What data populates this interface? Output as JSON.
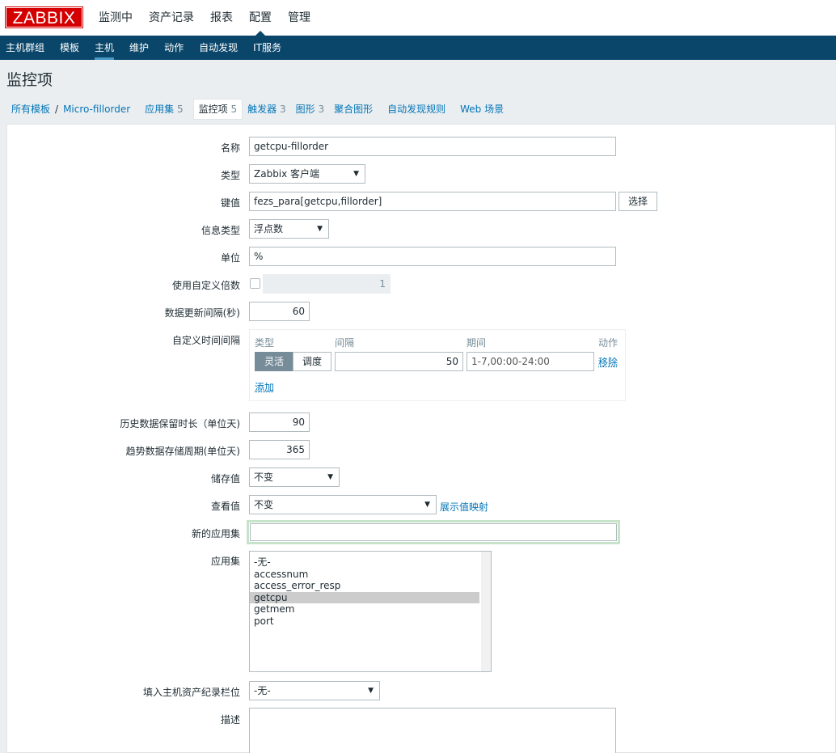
{
  "logo": "ZABBIX",
  "top_nav": [
    "监测中",
    "资产记录",
    "报表",
    "配置",
    "管理"
  ],
  "top_nav_active": "配置",
  "sub_nav": [
    "主机群组",
    "模板",
    "主机",
    "维护",
    "动作",
    "自动发现",
    "IT服务"
  ],
  "sub_nav_active": "主机",
  "page_title": "监控项",
  "breadcrumb": {
    "all_templates": "所有模板",
    "separator": "/",
    "template": "Micro-fillorder",
    "tabs": [
      {
        "label": "应用集",
        "count": "5"
      },
      {
        "label": "监控项",
        "count": "5"
      },
      {
        "label": "触发器",
        "count": "3"
      },
      {
        "label": "图形",
        "count": "3"
      },
      {
        "label": "聚合图形",
        "count": ""
      },
      {
        "label": "自动发现规则",
        "count": ""
      },
      {
        "label": "Web 场景",
        "count": ""
      }
    ],
    "active_tab": "监控项"
  },
  "form": {
    "name_label": "名称",
    "name_value": "getcpu-fillorder",
    "type_label": "类型",
    "type_value": "Zabbix 客户端",
    "key_label": "键值",
    "key_value": "fezs_para[getcpu,fillorder]",
    "key_select_button": "选择",
    "info_type_label": "信息类型",
    "info_type_value": "浮点数",
    "units_label": "单位",
    "units_value": "%",
    "multiplier_label": "使用自定义倍数",
    "multiplier_value": "1",
    "update_interval_label": "数据更新间隔(秒)",
    "update_interval_value": "60",
    "custom_intervals_label": "自定义时间间隔",
    "custom_intervals": {
      "headers": {
        "type": "类型",
        "interval": "间隔",
        "period": "期间",
        "action": "动作"
      },
      "row": {
        "flexible": "灵活",
        "scheduling": "调度",
        "interval": "50",
        "period": "1-7,00:00-24:00",
        "remove": "移除"
      },
      "add": "添加"
    },
    "history_label": "历史数据保留时长（单位天)",
    "history_value": "90",
    "trends_label": "趋势数据存储周期(单位天)",
    "trends_value": "365",
    "store_value_label": "储存值",
    "store_value_value": "不变",
    "show_value_label": "查看值",
    "show_value_value": "不变",
    "show_value_link": "展示值映射",
    "new_app_label": "新的应用集",
    "new_app_value": "",
    "applications_label": "应用集",
    "applications": [
      "-无-",
      "accessnum",
      "access_error_resp",
      "getcpu",
      "getmem",
      "port"
    ],
    "applications_selected": "getcpu",
    "inventory_label": "填入主机资产纪录栏位",
    "inventory_value": "-无-",
    "description_label": "描述"
  }
}
